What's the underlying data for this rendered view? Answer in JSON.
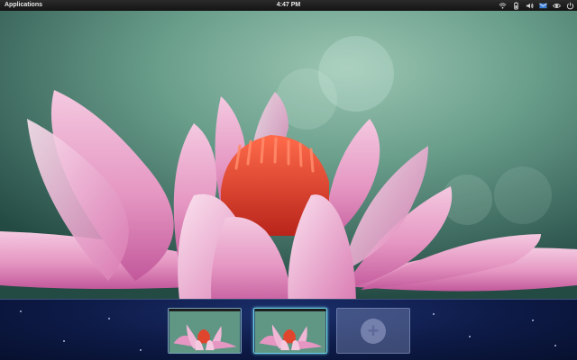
{
  "topbar": {
    "applications_label": "Applications",
    "clock": "4:47 PM",
    "indicators": [
      "wifi-icon",
      "battery-icon",
      "volume-icon",
      "mail-icon",
      "eye-icon",
      "power-icon"
    ]
  },
  "wallpaper": {
    "subject": "pink water lily",
    "colors": {
      "background": "#5f9684",
      "petal": "#e7a1c8",
      "center": "#e0462e"
    }
  },
  "workspaces": {
    "items": [
      {
        "index": 1,
        "active": false
      },
      {
        "index": 2,
        "active": true
      }
    ],
    "add_symbol": "+"
  },
  "colors": {
    "accent": "#6fd3e8",
    "topbar": "#1e1e1e",
    "workspace_bar": "#0d1a46"
  }
}
